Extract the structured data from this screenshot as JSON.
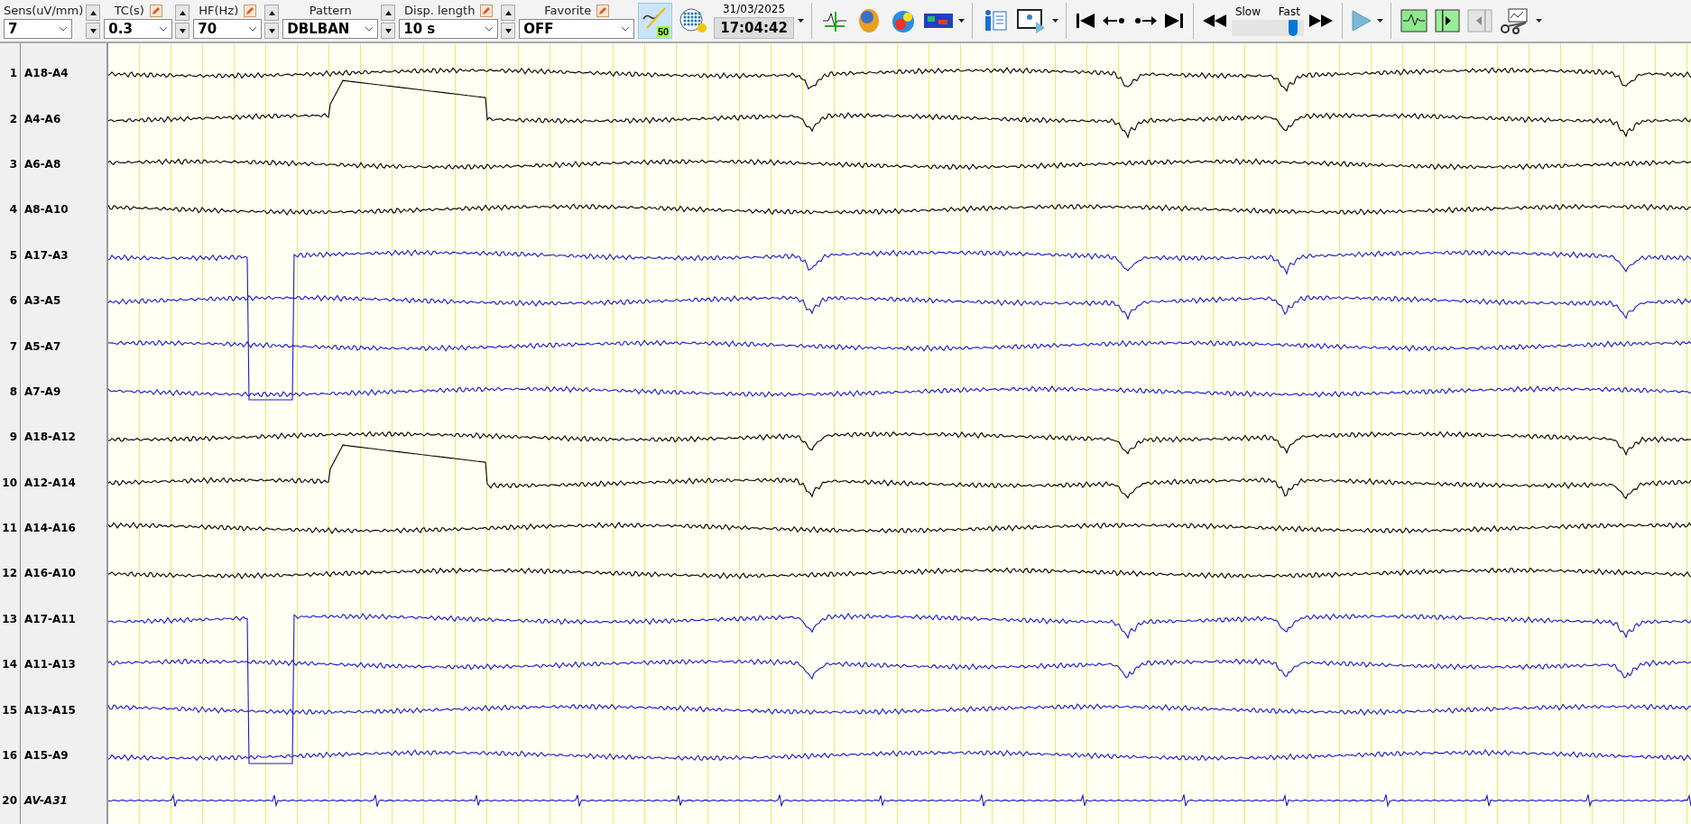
{
  "toolbar": {
    "fields": [
      {
        "label": "Sens(uV/mm)",
        "value": "7",
        "editable": false,
        "spinner": true
      },
      {
        "label": "TC(s)",
        "value": "0.3",
        "editable": true,
        "spinner": true
      },
      {
        "label": "HF(Hz)",
        "value": "70",
        "editable": true,
        "spinner": true
      },
      {
        "label": "Pattern",
        "value": "DBLBAN",
        "editable": false,
        "spinner": true
      },
      {
        "label": "Disp. length",
        "value": "10 s",
        "editable": true,
        "spinner": true
      },
      {
        "label": "Favorite",
        "value": "OFF",
        "editable": true,
        "spinner": false
      }
    ],
    "notch": {
      "label": "50",
      "selected": true
    },
    "date": "31/03/2025",
    "time": "17:04:42",
    "speed": {
      "slow": "Slow",
      "fast": "Fast",
      "level": 0.85
    }
  },
  "channels": [
    {
      "number": "1",
      "name": "A18-A4",
      "color": "#000000",
      "kind": "bipolar"
    },
    {
      "number": "2",
      "name": "A4-A6",
      "color": "#000000",
      "kind": "bipolar"
    },
    {
      "number": "3",
      "name": "A6-A8",
      "color": "#000000",
      "kind": "bipolar"
    },
    {
      "number": "4",
      "name": "A8-A10",
      "color": "#000000",
      "kind": "bipolar"
    },
    {
      "number": "5",
      "name": "A17-A3",
      "color": "#1a1acc",
      "kind": "bipolar"
    },
    {
      "number": "6",
      "name": "A3-A5",
      "color": "#1a1acc",
      "kind": "bipolar"
    },
    {
      "number": "7",
      "name": "A5-A7",
      "color": "#1a1acc",
      "kind": "bipolar"
    },
    {
      "number": "8",
      "name": "A7-A9",
      "color": "#1a1acc",
      "kind": "bipolar"
    },
    {
      "number": "9",
      "name": "A18-A12",
      "color": "#000000",
      "kind": "bipolar"
    },
    {
      "number": "10",
      "name": "A12-A14",
      "color": "#000000",
      "kind": "bipolar"
    },
    {
      "number": "11",
      "name": "A14-A16",
      "color": "#000000",
      "kind": "bipolar"
    },
    {
      "number": "12",
      "name": "A16-A10",
      "color": "#000000",
      "kind": "bipolar"
    },
    {
      "number": "13",
      "name": "A17-A11",
      "color": "#1a1acc",
      "kind": "bipolar"
    },
    {
      "number": "14",
      "name": "A11-A13",
      "color": "#1a1acc",
      "kind": "bipolar"
    },
    {
      "number": "15",
      "name": "A13-A15",
      "color": "#1a1acc",
      "kind": "bipolar"
    },
    {
      "number": "16",
      "name": "A15-A9",
      "color": "#1a1acc",
      "kind": "bipolar"
    },
    {
      "number": "20",
      "name": "AV-A31",
      "color": "#1a1acc",
      "kind": "average"
    }
  ]
}
